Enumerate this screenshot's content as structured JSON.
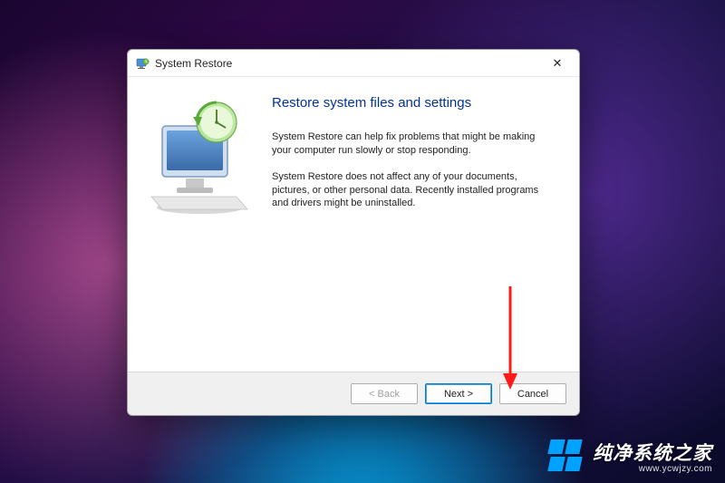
{
  "titlebar": {
    "title": "System Restore",
    "close_symbol": "✕"
  },
  "content": {
    "heading": "Restore system files and settings",
    "paragraph1": "System Restore can help fix problems that might be making your computer run slowly or stop responding.",
    "paragraph2": "System Restore does not affect any of your documents, pictures, or other personal data. Recently installed programs and drivers might be uninstalled."
  },
  "footer": {
    "back_label": "< Back",
    "next_label": "Next >",
    "cancel_label": "Cancel"
  },
  "watermark": {
    "brand": "纯净系统之家",
    "domain": "www.ycwjzy.com"
  }
}
